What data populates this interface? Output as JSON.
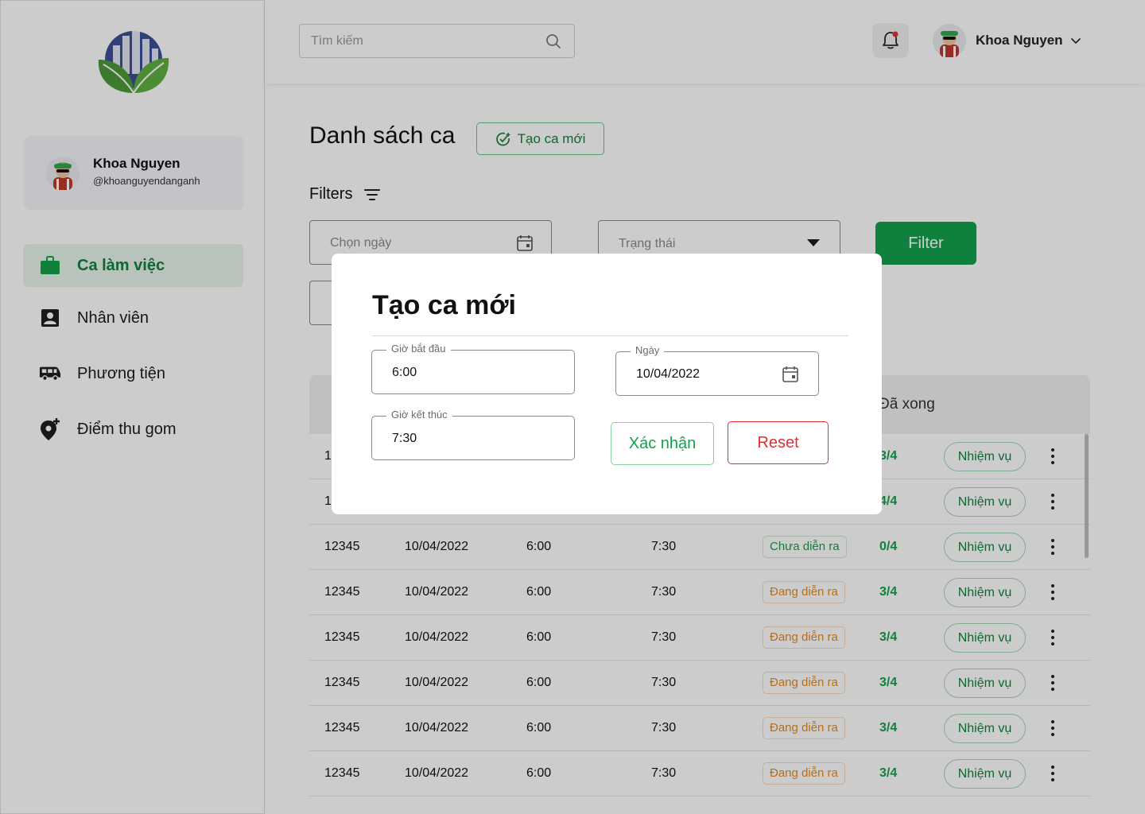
{
  "sidebar": {
    "profile": {
      "name": "Khoa Nguyen",
      "handle": "@khoanguyendanganh"
    },
    "items": [
      {
        "label": "Ca làm việc",
        "icon": "briefcase-icon",
        "active": true
      },
      {
        "label": "Nhân viên",
        "icon": "contact-card-icon",
        "active": false
      },
      {
        "label": "Phương tiện",
        "icon": "bus-icon",
        "active": false
      },
      {
        "label": "Điểm thu gom",
        "icon": "add-location-icon",
        "active": false
      }
    ]
  },
  "topbar": {
    "search_placeholder": "Tìm kiếm",
    "user_name": "Khoa Nguyen"
  },
  "main": {
    "title": "Danh sách ca",
    "create_label": "Tạo ca mới",
    "filters_label": "Filters",
    "date_placeholder": "Chọn ngày",
    "status_placeholder": "Trạng thái",
    "filter_button": "Filter"
  },
  "table": {
    "header_done": "Đã xong",
    "task_label": "Nhiệm vụ",
    "rows": [
      {
        "id": "12345",
        "date": "10/04/2022",
        "start": "6:00",
        "end": "7:30",
        "status": "Chưa diễn ra",
        "done": "0/4"
      },
      {
        "id": "12345",
        "date": "10/04/2022",
        "start": "6:00",
        "end": "7:30",
        "status": "Đang diễn ra",
        "done": "3/4"
      },
      {
        "id": "12345",
        "date": "10/04/2022",
        "start": "6:00",
        "end": "7:30",
        "status": "Đang diễn ra",
        "done": "3/4"
      },
      {
        "id": "12345",
        "date": "10/04/2022",
        "start": "6:00",
        "end": "7:30",
        "status": "Đang diễn ra",
        "done": "3/4"
      },
      {
        "id": "12345",
        "date": "10/04/2022",
        "start": "6:00",
        "end": "7:30",
        "status": "Đang diễn ra",
        "done": "3/4"
      },
      {
        "id": "12345",
        "date": "10/04/2022",
        "start": "6:00",
        "end": "7:30",
        "status": "Đang diễn ra",
        "done": "3/4"
      }
    ],
    "partial_rows": [
      {
        "id_partial": "1",
        "done": "3/4"
      },
      {
        "id_partial": "1",
        "done": "4/4"
      }
    ]
  },
  "modal": {
    "title": "Tạo ca mới",
    "start_label": "Giờ bắt đầu",
    "start_value": "6:00",
    "end_label": "Giờ kết thúc",
    "end_value": "7:30",
    "date_label": "Ngày",
    "date_value": "10/04/2022",
    "confirm_label": "Xác nhận",
    "reset_label": "Reset"
  },
  "colors": {
    "brand_green": "#13a24c",
    "active_bg": "#e6f4ea",
    "progress_orange": "#e58a1f",
    "danger_red": "#e03131"
  }
}
